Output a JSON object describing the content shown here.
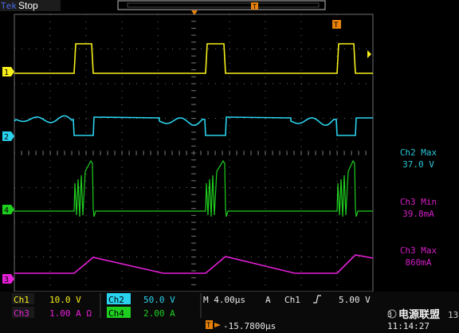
{
  "top_bar": {
    "brand": "Tek",
    "state": "Stop",
    "trigger_marker": "T"
  },
  "channels": [
    {
      "id": "1",
      "name": "Ch1",
      "scale": "10.0 V",
      "color": "#f7f01a"
    },
    {
      "id": "2",
      "name": "Ch2",
      "scale": "50.0 V",
      "color": "#29d3ee"
    },
    {
      "id": "3",
      "name": "Ch3",
      "scale": "1.00 A Ω",
      "color": "#e61fd8"
    },
    {
      "id": "4",
      "name": "Ch4",
      "scale": "2.00 A",
      "color": "#1fcf1f"
    }
  ],
  "measurements": [
    {
      "label": "Ch2 Max",
      "value": "37.0 V",
      "color": "#29c7d8"
    },
    {
      "label": "Ch3 Min",
      "value": "39.8mA",
      "color": "#d31fc6"
    },
    {
      "label": "Ch3 Max",
      "value": "860mA",
      "color": "#d31fc6"
    }
  ],
  "timebase": {
    "label": "M 4.00µs",
    "mode": "A",
    "trigger_source": "Ch1",
    "trigger_level": "5.00 V"
  },
  "trigger_position": {
    "marker": "T",
    "value": "-15.7800µs"
  },
  "watermark": {
    "text": "电源联盟",
    "prefix": "3",
    "suffix": "13"
  },
  "timestamp": "11:14:27",
  "colors": {
    "grid": "#6e6e6e",
    "ui_orange": "#e8820a",
    "ui_bg": "#1a1a1a"
  }
}
